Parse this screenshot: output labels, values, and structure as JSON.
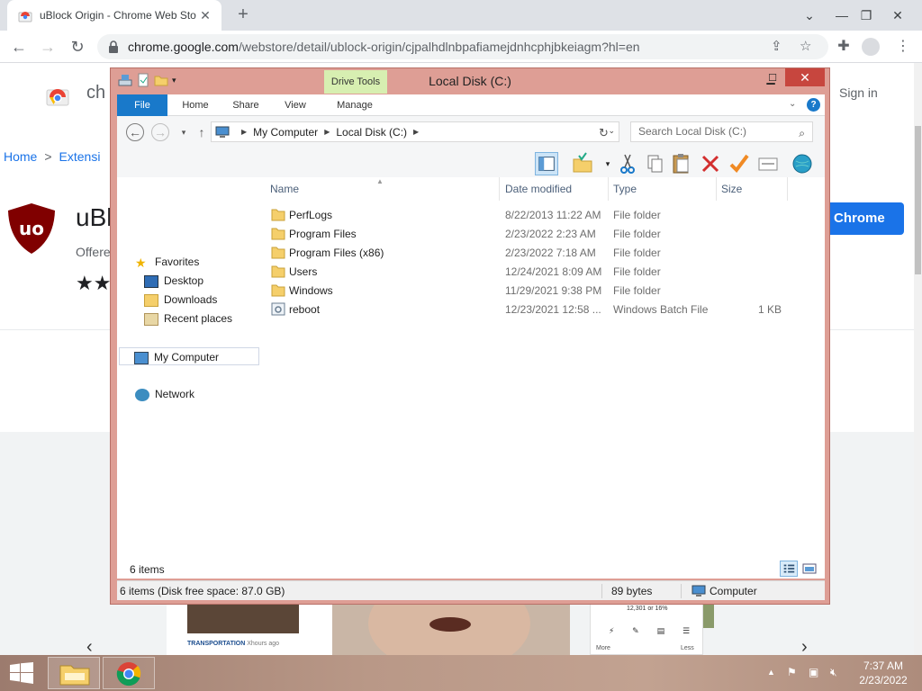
{
  "browser": {
    "tab_title": "uBlock Origin - Chrome Web Sto",
    "url_host": "chrome.google.com",
    "url_path": "/webstore/detail/ublock-origin/cjpalhdlnbpafiamejdnhcphjbkeiagm?hl=en"
  },
  "store": {
    "brand": "ch",
    "sign_in": "Sign in",
    "breadcrumb_home": "Home",
    "breadcrumb_sep": ">",
    "breadcrumb_ext": "Extensi",
    "ext_name": "uBl",
    "offered": "Offere",
    "stars": "★★",
    "add_button": "Chrome",
    "thumb_caption": "TRANSPORTATION",
    "thumb_caption_time": "Xhours ago",
    "thumb3_value": "12,301 or 16%",
    "thumb3_more": "More",
    "thumb3_less": "Less"
  },
  "explorer": {
    "title": "Local Disk (C:)",
    "drive_tools": "Drive Tools",
    "ribbon_tabs": [
      "File",
      "Home",
      "Share",
      "View",
      "Manage"
    ],
    "address": [
      "My Computer",
      "Local Disk (C:)"
    ],
    "search_placeholder": "Search Local Disk (C:)",
    "nav": {
      "favorites": "Favorites",
      "desktop": "Desktop",
      "downloads": "Downloads",
      "recent": "Recent places",
      "computer": "My Computer",
      "network": "Network"
    },
    "columns": {
      "name": "Name",
      "date": "Date modified",
      "type": "Type",
      "size": "Size"
    },
    "files": [
      {
        "name": "PerfLogs",
        "date": "8/22/2013 11:22 AM",
        "type": "File folder",
        "size": "",
        "icon": "folder-icon"
      },
      {
        "name": "Program Files",
        "date": "2/23/2022 2:23 AM",
        "type": "File folder",
        "size": "",
        "icon": "folder-icon"
      },
      {
        "name": "Program Files (x86)",
        "date": "2/23/2022 7:18 AM",
        "type": "File folder",
        "size": "",
        "icon": "folder-icon"
      },
      {
        "name": "Users",
        "date": "12/24/2021 8:09 AM",
        "type": "File folder",
        "size": "",
        "icon": "folder-icon"
      },
      {
        "name": "Windows",
        "date": "11/29/2021 9:38 PM",
        "type": "File folder",
        "size": "",
        "icon": "folder-icon"
      },
      {
        "name": "reboot",
        "date": "12/23/2021 12:58 ...",
        "type": "Windows Batch File",
        "size": "1 KB",
        "icon": "batch-file-icon"
      }
    ],
    "item_count": "6 items",
    "status_left": "6 items (Disk free space: 87.0 GB)",
    "status_mid": "89 bytes",
    "status_right": "Computer"
  },
  "taskbar": {
    "time": "7:37 AM",
    "date": "2/23/2022"
  },
  "colors": {
    "explorer_frame": "#de9e95",
    "file_tab": "#1979ca",
    "drive_tools": "#d7efb1",
    "chrome_blue": "#1a73e8"
  }
}
